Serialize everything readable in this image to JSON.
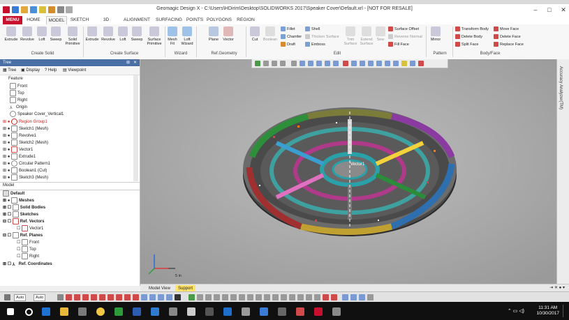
{
  "window": {
    "title": "Geomagic Design X - C:\\Users\\HDirim\\Desktop\\SOLIDWORKS 2017\\Speaker Cover\\Default.xrl - [NOT FOR RESALE]",
    "controls": [
      "–",
      "□",
      "✕"
    ]
  },
  "ribbon_tabs": [
    "MENU",
    "HOME",
    "MODEL",
    "SKETCH",
    "3D SKETCH",
    "ALIGNMENT",
    "SURFACING",
    "POINTS",
    "POLYGONS",
    "REGION"
  ],
  "active_tab": "MODEL",
  "ribbon": {
    "create_solid": {
      "label": "Create Solid",
      "buttons": [
        "Extrude",
        "Revolve",
        "Loft",
        "Sweep",
        "Solid Primitive"
      ]
    },
    "create_surface": {
      "label": "Create Surface",
      "buttons": [
        "Extrude",
        "Revolve",
        "Loft",
        "Sweep",
        "Surface Primitive"
      ]
    },
    "wizard": {
      "label": "Wizard",
      "buttons": [
        "Mesh Fit",
        "Loft Wizard"
      ]
    },
    "ref_geometry": {
      "label": "Ref.Geometry",
      "buttons": [
        "Plane",
        "Vector"
      ]
    },
    "edit": {
      "label": "Edit",
      "buttons": [
        "Cut",
        "Boolean"
      ],
      "small_cmds": [
        "Fillet",
        "Chamfer",
        "Draft",
        "Shell",
        "Thicken Surface",
        "Emboss",
        "Trim Surface",
        "Extend Surface",
        "Sew",
        "Surface Offset",
        "Reverse Normal",
        "Fill Face"
      ]
    },
    "pattern": {
      "label": "Pattern",
      "buttons": [
        "Mirror"
      ]
    },
    "body_face": {
      "label": "Body/Face",
      "small_cmds": [
        "Transform Body",
        "Delete Body",
        "Split Face",
        "Move Face",
        "Delete Face",
        "Replace Face"
      ]
    }
  },
  "tree_panel": {
    "title": "Tree",
    "tabs": [
      "Tree",
      "Display",
      "Help",
      "Viewpoint"
    ],
    "feature_header": "Feature",
    "features": [
      {
        "label": "Front",
        "color": "normal"
      },
      {
        "label": "Top",
        "color": "normal"
      },
      {
        "label": "Right",
        "color": "normal"
      },
      {
        "label": "Origin",
        "color": "normal"
      },
      {
        "label": "Speaker Cover_Vertical1",
        "color": "normal"
      },
      {
        "label": "Region Group1",
        "color": "red"
      },
      {
        "label": "Sketch1 (Mesh)",
        "color": "normal"
      },
      {
        "label": "Revolve1",
        "color": "normal"
      },
      {
        "label": "Sketch2 (Mesh)",
        "color": "normal"
      },
      {
        "label": "Vector1",
        "color": "normal"
      },
      {
        "label": "Extrude1",
        "color": "normal"
      },
      {
        "label": "Circular Pattern1",
        "color": "normal"
      },
      {
        "label": "Boolean1 (Cut)",
        "color": "normal"
      },
      {
        "label": "Sketch3 (Mesh)",
        "color": "normal"
      }
    ],
    "model_header": "Model",
    "model_items": [
      {
        "label": "Default",
        "bold": true
      },
      {
        "label": "Meshes",
        "bold": true
      },
      {
        "label": "Solid Bodies",
        "bold": true
      },
      {
        "label": "Sketches",
        "bold": true
      },
      {
        "label": "Ref. Vectors",
        "bold": true
      },
      {
        "label": "Vector1",
        "bold": false
      },
      {
        "label": "Ref. Planes",
        "bold": true
      },
      {
        "label": "Front",
        "bold": false
      },
      {
        "label": "Top",
        "bold": false
      },
      {
        "label": "Right",
        "bold": false
      },
      {
        "label": "Ref. Coordinates",
        "bold": true
      }
    ]
  },
  "viewport": {
    "vector_label": "Vector1",
    "scale_label": "5 in"
  },
  "right_panel": {
    "label": "Accuracy Analyzer(TM)"
  },
  "bottom_tabs": [
    "Model View",
    "Support"
  ],
  "status": {
    "field1": "Auto",
    "field2": "Auto"
  },
  "taskbar": {
    "time": "11:31 AM",
    "date": "10/30/2017"
  },
  "colors": {
    "accent": "#c8102e",
    "tree_title": "#4a6fa5",
    "viewport": "#a7a7a7"
  }
}
